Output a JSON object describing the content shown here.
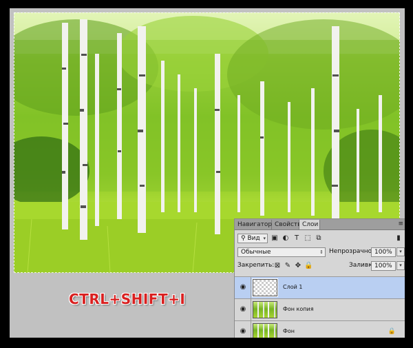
{
  "shortcut": {
    "text": "CTRL+SHIFT+I"
  },
  "layers_panel": {
    "tabs": [
      {
        "label": "Навигатор",
        "active": false
      },
      {
        "label": "Свойства",
        "active": false
      },
      {
        "label": "Слои",
        "active": true
      }
    ],
    "menu_icon": "panel-menu-icon",
    "filter": {
      "icon": "search-icon",
      "value": "Вид"
    },
    "blend_mode": {
      "value": "Обычные"
    },
    "opacity": {
      "label": "Непрозрачность:",
      "value": "100%"
    },
    "lock": {
      "label": "Закрепить:"
    },
    "fill": {
      "label": "Заливка:",
      "value": "100%"
    },
    "layers": [
      {
        "name": "Слой 1",
        "selected": true,
        "thumbnail": "transparent",
        "locked": false
      },
      {
        "name": "Фон копия",
        "selected": false,
        "thumbnail": "photo",
        "locked": false
      },
      {
        "name": "Фон",
        "selected": false,
        "thumbnail": "photo",
        "locked": true
      }
    ]
  },
  "colors": {
    "workspace": "#c1c1c1",
    "panel": "#d6d6d6",
    "selected_layer": "#b9cff2",
    "shortcut_text": "#d92020"
  }
}
